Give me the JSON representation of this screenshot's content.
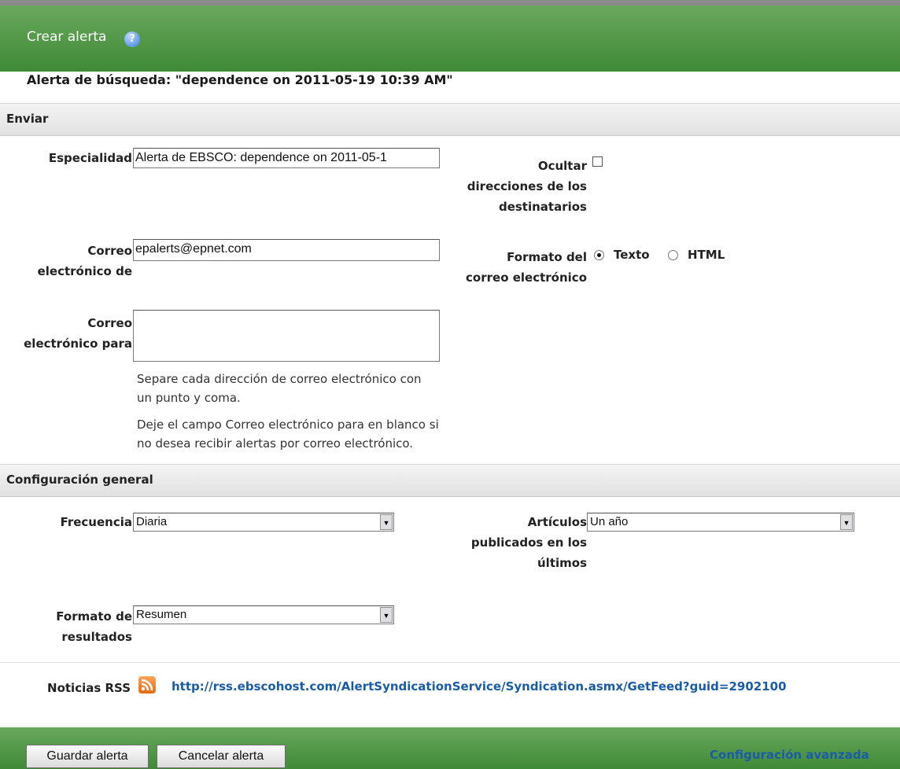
{
  "header": {
    "title": "Crear alerta",
    "help_icon": "help-icon"
  },
  "search_title": "Alerta de búsqueda: \"dependence on 2011-05-19 10:39 AM\"",
  "send_section": {
    "title": "Enviar",
    "subject_label": "Especialidad",
    "subject_value": "Alerta de EBSCO: dependence on 2011-05-1",
    "hide_recipients_label_line1": "Ocultar",
    "hide_recipients_label_line2": "direcciones de los",
    "hide_recipients_label_line3": "destinatarios",
    "hide_recipients_checked": false,
    "from_label_line1": "Correo",
    "from_label_line2": "electrónico de",
    "from_value": "epalerts@epnet.com",
    "format_label_line1": "Formato del",
    "format_label_line2": "correo electrónico",
    "format_option_text": "Texto",
    "format_option_html": "HTML",
    "format_selected": "Texto",
    "to_label_line1": "Correo",
    "to_label_line2": "electrónico para",
    "to_value": "",
    "hint1_line1": "Separe cada dirección de correo electrónico con",
    "hint1_line2": "un punto y coma.",
    "hint2_line1": "Deje el campo Correo electrónico para en blanco si",
    "hint2_line2": "no desea recibir alertas por correo electrónico."
  },
  "general_section": {
    "title": "Configuración general",
    "frequency_label": "Frecuencia",
    "frequency_value": "Diaria",
    "articles_label_line1": "Artículos",
    "articles_label_line2": "publicados en los",
    "articles_label_line3": "últimos",
    "articles_value": "Un año",
    "results_format_label_line1": "Formato de",
    "results_format_label_line2": "resultados",
    "results_format_value": "Resumen",
    "rss_label": "Noticias RSS",
    "rss_icon": "rss-icon",
    "rss_url": "http://rss.ebscohost.com/AlertSyndicationService/Syndication.asmx/GetFeed?guid=2902100"
  },
  "footer": {
    "save_label": "Guardar alerta",
    "cancel_label": "Cancelar alerta",
    "advanced_link": "Configuración avanzada"
  }
}
